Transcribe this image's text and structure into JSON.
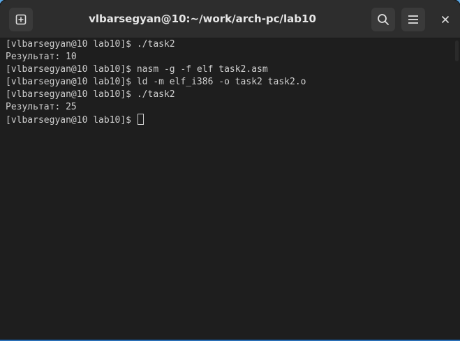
{
  "window": {
    "title": "vlbarsegyan@10:~/work/arch-pc/lab10"
  },
  "toolbar": {
    "new_tab_icon": "new-tab-icon",
    "search_icon": "search-icon",
    "menu_icon": "hamburger-menu-icon",
    "close_icon": "close-icon"
  },
  "terminal": {
    "lines": [
      "[vlbarsegyan@10 lab10]$ ./task2",
      "Результат: 10",
      "[vlbarsegyan@10 lab10]$ nasm -g -f elf task2.asm",
      "[vlbarsegyan@10 lab10]$ ld -m elf_i386 -o task2 task2.o",
      "[vlbarsegyan@10 lab10]$ ./task2",
      "Результат: 25"
    ],
    "prompt": "[vlbarsegyan@10 lab10]$ "
  },
  "colors": {
    "titlebar_bg": "#2d2d2d",
    "terminal_bg": "#1e1e1e",
    "terminal_fg": "#d0d0d0",
    "desktop": "#3a8ad0"
  }
}
